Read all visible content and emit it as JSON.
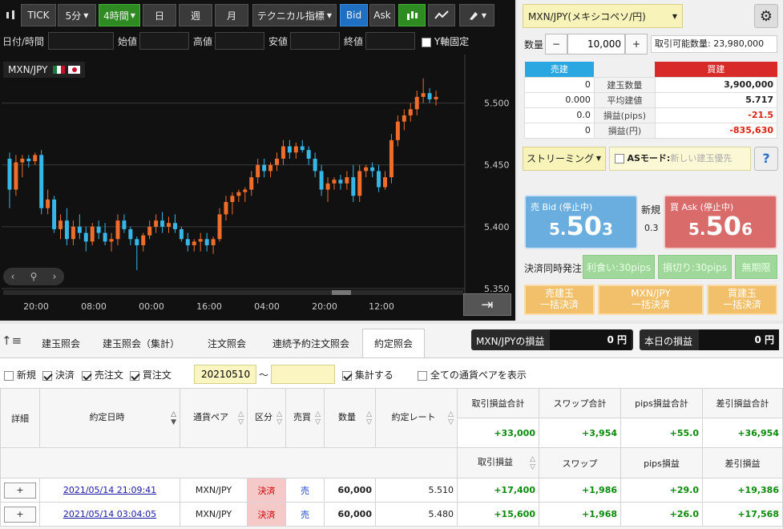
{
  "toolbar": {
    "tick": "TICK",
    "interval": "5分",
    "timeframe": "4時間",
    "day": "日",
    "week": "週",
    "month": "月",
    "indicator": "テクニカル指標",
    "bid": "Bid",
    "ask": "Ask"
  },
  "fields": {
    "datetime": "日付/時間",
    "open": "始値",
    "high": "高値",
    "low": "安値",
    "close": "終値",
    "yfix": "Y軸固定"
  },
  "chart": {
    "symbol": "MXN/JPY",
    "y_ticks": [
      "5.500",
      "5.450",
      "5.400",
      "5.350"
    ],
    "x_ticks": [
      "20:00",
      "08:00",
      "00:00",
      "16:00",
      "04:00",
      "20:00",
      "12:00"
    ]
  },
  "chart_data": {
    "type": "candlestick",
    "ylim": [
      5.35,
      5.525
    ],
    "y_ticks": [
      5.5,
      5.45,
      5.4,
      5.35
    ],
    "x_ticks": [
      "20:00",
      "08:00",
      "00:00",
      "16:00",
      "04:00",
      "20:00",
      "12:00"
    ],
    "ohlc": [
      [
        5.455,
        5.46,
        5.415,
        5.43
      ],
      [
        5.43,
        5.458,
        5.425,
        5.452
      ],
      [
        5.452,
        5.458,
        5.44,
        5.455
      ],
      [
        5.455,
        5.458,
        5.448,
        5.453
      ],
      [
        5.453,
        5.46,
        5.45,
        5.458
      ],
      [
        5.458,
        5.462,
        5.41,
        5.415
      ],
      [
        5.415,
        5.43,
        5.41,
        5.422
      ],
      [
        5.422,
        5.425,
        5.395,
        5.398
      ],
      [
        5.398,
        5.41,
        5.39,
        5.405
      ],
      [
        5.405,
        5.415,
        5.385,
        5.39
      ],
      [
        5.39,
        5.405,
        5.385,
        5.4
      ],
      [
        5.4,
        5.41,
        5.39,
        5.395
      ],
      [
        5.395,
        5.4,
        5.38,
        5.388
      ],
      [
        5.388,
        5.403,
        5.385,
        5.4
      ],
      [
        5.4,
        5.405,
        5.39,
        5.395
      ],
      [
        5.395,
        5.403,
        5.385,
        5.388
      ],
      [
        5.388,
        5.395,
        5.38,
        5.39
      ],
      [
        5.39,
        5.41,
        5.385,
        5.405
      ],
      [
        5.405,
        5.41,
        5.395,
        5.398
      ],
      [
        5.398,
        5.4,
        5.385,
        5.39
      ],
      [
        5.39,
        5.392,
        5.365,
        5.385
      ],
      [
        5.385,
        5.395,
        5.38,
        5.393
      ],
      [
        5.393,
        5.405,
        5.39,
        5.4
      ],
      [
        5.4,
        5.41,
        5.395,
        5.405
      ],
      [
        5.405,
        5.412,
        5.395,
        5.4
      ],
      [
        5.4,
        5.408,
        5.395,
        5.403
      ],
      [
        5.403,
        5.41,
        5.395,
        5.398
      ],
      [
        5.398,
        5.4,
        5.388,
        5.39
      ],
      [
        5.39,
        5.395,
        5.38,
        5.385
      ],
      [
        5.385,
        5.39,
        5.38,
        5.388
      ],
      [
        5.388,
        5.395,
        5.38,
        5.39
      ],
      [
        5.39,
        5.395,
        5.38,
        5.385
      ],
      [
        5.385,
        5.392,
        5.378,
        5.39
      ],
      [
        5.39,
        5.415,
        5.388,
        5.41
      ],
      [
        5.41,
        5.425,
        5.405,
        5.42
      ],
      [
        5.42,
        5.428,
        5.41,
        5.425
      ],
      [
        5.425,
        5.43,
        5.42,
        5.428
      ],
      [
        5.428,
        5.432,
        5.42,
        5.43
      ],
      [
        5.43,
        5.445,
        5.425,
        5.44
      ],
      [
        5.44,
        5.455,
        5.435,
        5.45
      ],
      [
        5.45,
        5.455,
        5.44,
        5.445
      ],
      [
        5.445,
        5.452,
        5.44,
        5.45
      ],
      [
        5.45,
        5.46,
        5.445,
        5.455
      ],
      [
        5.455,
        5.47,
        5.45,
        5.465
      ],
      [
        5.465,
        5.47,
        5.455,
        5.46
      ],
      [
        5.46,
        5.468,
        5.455,
        5.465
      ],
      [
        5.465,
        5.47,
        5.46,
        5.462
      ],
      [
        5.462,
        5.465,
        5.45,
        5.455
      ],
      [
        5.455,
        5.46,
        5.44,
        5.445
      ],
      [
        5.445,
        5.45,
        5.425,
        5.43
      ],
      [
        5.43,
        5.44,
        5.42,
        5.435
      ],
      [
        5.435,
        5.44,
        5.43,
        5.438
      ],
      [
        5.438,
        5.442,
        5.43,
        5.435
      ],
      [
        5.435,
        5.445,
        5.43,
        5.44
      ],
      [
        5.44,
        5.45,
        5.42,
        5.425
      ],
      [
        5.425,
        5.45,
        5.42,
        5.445
      ],
      [
        5.445,
        5.45,
        5.44,
        5.448
      ],
      [
        5.448,
        5.452,
        5.44,
        5.445
      ],
      [
        5.445,
        5.45,
        5.428,
        5.432
      ],
      [
        5.432,
        5.445,
        5.43,
        5.44
      ],
      [
        5.44,
        5.475,
        5.435,
        5.47
      ],
      [
        5.47,
        5.49,
        5.465,
        5.485
      ],
      [
        5.485,
        5.495,
        5.478,
        5.49
      ],
      [
        5.49,
        5.5,
        5.485,
        5.495
      ],
      [
        5.495,
        5.51,
        5.49,
        5.505
      ],
      [
        5.505,
        5.52,
        5.5,
        5.508
      ],
      [
        5.508,
        5.512,
        5.5,
        5.503
      ],
      [
        5.503,
        5.51,
        5.498,
        5.505
      ]
    ]
  },
  "order": {
    "pair": "MXN/JPY(メキシコペソ/円)",
    "qty_label": "数量",
    "qty": "10,000",
    "available": "取引可能数量: 23,980,000",
    "sell_head": "売建",
    "buy_head": "買建",
    "rows": [
      {
        "sell": "0",
        "label": "建玉数量",
        "buy": "3,900,000"
      },
      {
        "sell": "0.000",
        "label": "平均建値",
        "buy": "5.717"
      },
      {
        "sell": "0.0",
        "label": "損益(pips)",
        "buy": "-21.5"
      },
      {
        "sell": "0",
        "label": "損益(円)",
        "buy": "-835,630"
      }
    ],
    "streaming": "ストリーミング",
    "as_mode": "ASモード:",
    "as_placeholder": "新しい建玉優先",
    "help": "?",
    "bid_label": "売 Bid (停止中)",
    "bid_small": "5.",
    "bid_big": "50",
    "bid_last": "3",
    "new_label": "新規",
    "spread": "0.3",
    "ask_label": "買 Ask (停止中)",
    "ask_small": "5.",
    "ask_big": "50",
    "ask_last": "6",
    "simul": "決済同時発注",
    "profit": "利食い:30pips",
    "loss": "損切り:30pips",
    "unlimited": "無期限",
    "btn1a": "売建玉",
    "btn1b": "一括決済",
    "btn2a": "MXN/JPY",
    "btn2b": "一括決済",
    "btn3a": "買建玉",
    "btn3b": "一括決済"
  },
  "tabs": [
    "建玉照会",
    "建玉照会（集計）",
    "注文照会",
    "連続予約注文照会",
    "約定照会"
  ],
  "pl": {
    "pair_label": "MXN/JPYの損益",
    "pair_value": "0 円",
    "today_label": "本日の損益",
    "today_value": "0 円"
  },
  "filters": {
    "new": "新規",
    "settle": "決済",
    "sell": "売注文",
    "buy": "買注文",
    "date_from": "20210510",
    "tilde": "〜",
    "aggregate": "集計する",
    "all_pairs": "全ての通貨ペアを表示"
  },
  "grid": {
    "h_detail": "詳細",
    "h_datetime": "約定日時",
    "h_pair": "通貨ペア",
    "h_kind": "区分",
    "h_side": "売買",
    "h_qty": "数量",
    "h_rate": "約定レート",
    "h_trade_total": "取引損益合計",
    "h_swap_total": "スワップ合計",
    "h_pips_total": "pips損益合計",
    "h_net_total": "差引損益合計",
    "t_trade": "+33,000",
    "t_swap": "+3,954",
    "t_pips": "+55.0",
    "t_net": "+36,954",
    "h_trade": "取引損益",
    "h_swap": "スワップ",
    "h_pips": "pips損益",
    "h_net": "差引損益",
    "rows": [
      {
        "plus": "+",
        "dt": "2021/05/14 21:09:41",
        "pair": "MXN/JPY",
        "kind": "決済",
        "side": "売",
        "qty": "60,000",
        "rate": "5.510",
        "trade": "+17,400",
        "swap": "+1,986",
        "pips": "+29.0",
        "net": "+19,386"
      },
      {
        "plus": "+",
        "dt": "2021/05/14 03:04:05",
        "pair": "MXN/JPY",
        "kind": "決済",
        "side": "売",
        "qty": "60,000",
        "rate": "5.480",
        "trade": "+15,600",
        "swap": "+1,968",
        "pips": "+26.0",
        "net": "+17,568"
      }
    ]
  }
}
